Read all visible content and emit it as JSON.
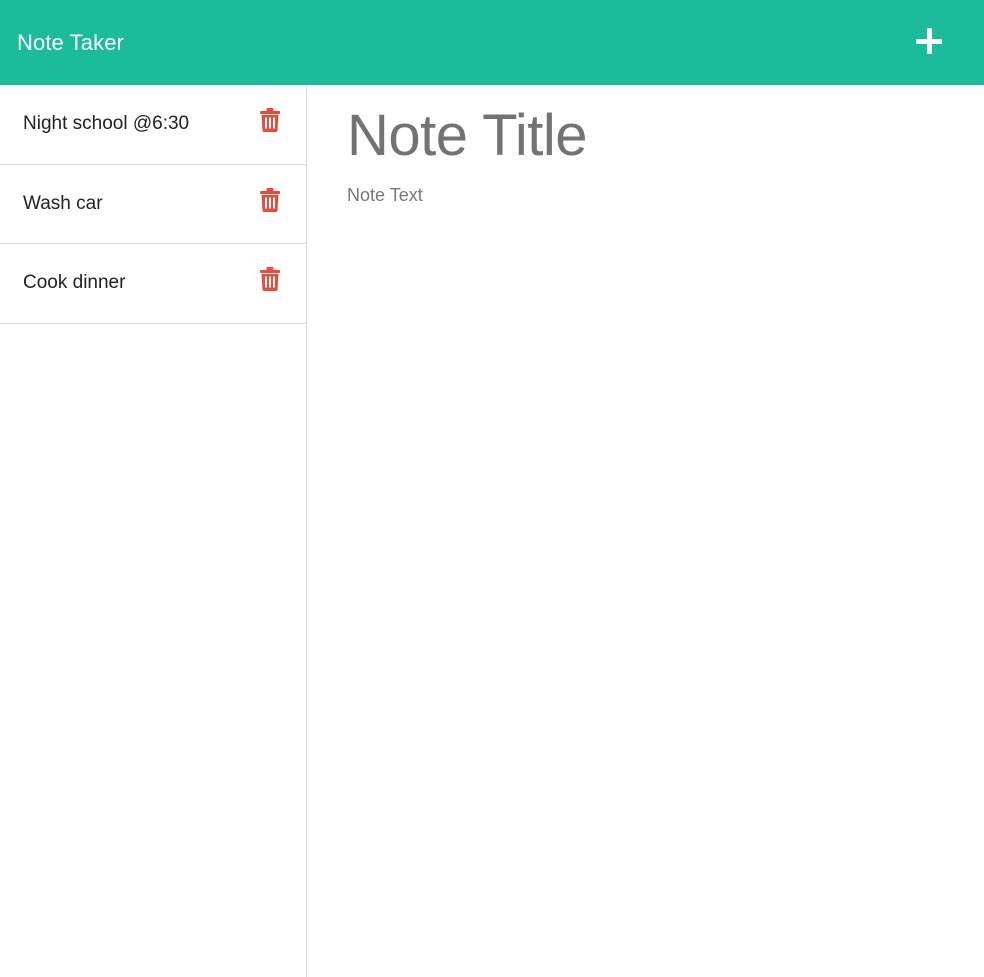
{
  "navbar": {
    "brand": "Note Taker",
    "add_icon": "plus-icon",
    "background": "#1abc9c"
  },
  "sidebar": {
    "notes": [
      {
        "label": "Night school @6:30",
        "delete_icon": "trash-icon"
      },
      {
        "label": "Wash car",
        "delete_icon": "trash-icon"
      },
      {
        "label": "Cook dinner",
        "delete_icon": "trash-icon"
      }
    ],
    "delete_color": "#e74c3c"
  },
  "editor": {
    "title_placeholder": "Note Title",
    "text_placeholder": "Note Text"
  }
}
